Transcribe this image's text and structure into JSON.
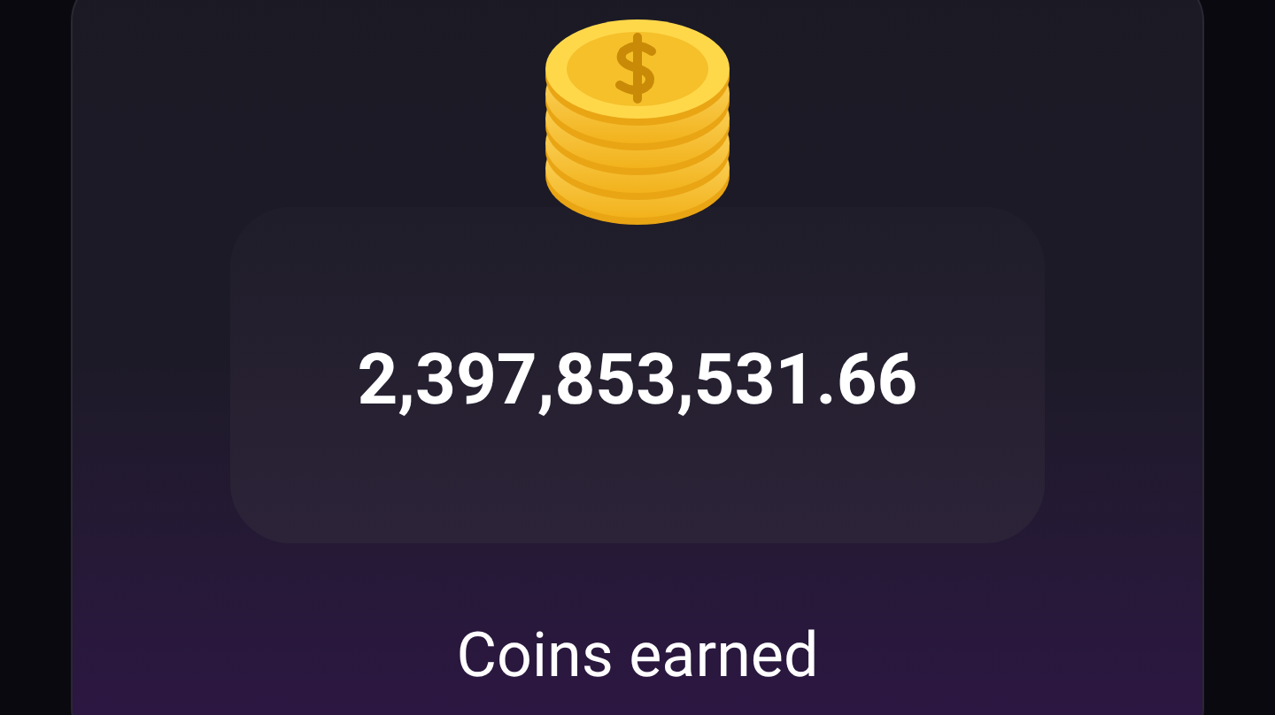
{
  "amount": "2,397,853,531.66",
  "caption": "Coins earned"
}
